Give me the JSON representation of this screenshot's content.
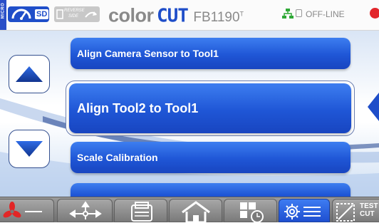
{
  "header": {
    "mode_label": "MICRO",
    "badge_label": "SD",
    "reverse_label": "REVERSE SIDE",
    "brand_color": "color",
    "brand_cut": "CUT",
    "model": "FB1190",
    "model_suffix": "T",
    "status": "OFF-LINE",
    "status_color": "#e2262b",
    "accent_color": "#1f4ec9",
    "network_icon": "network-icon",
    "lock_icon": "lock-icon"
  },
  "menu": {
    "items": [
      {
        "label": "Align Camera Sensor to Tool1"
      },
      {
        "label": "Align Tool2 to Tool1"
      },
      {
        "label": "Scale Calibration"
      },
      {
        "label": ""
      }
    ],
    "selected_index": 1
  },
  "toolbar": {
    "items": [
      {
        "icon": "fan-icon"
      },
      {
        "icon": "move-arrows-icon"
      },
      {
        "icon": "printer-icon"
      },
      {
        "icon": "home-icon"
      },
      {
        "icon": "job-history-icon"
      },
      {
        "icon": "settings-icon"
      },
      {
        "icon": "test-cut-icon",
        "label": "TEST\nCUT"
      }
    ],
    "active": "settings-icon",
    "test_label_line1": "TEST",
    "test_label_line2": "CUT"
  }
}
